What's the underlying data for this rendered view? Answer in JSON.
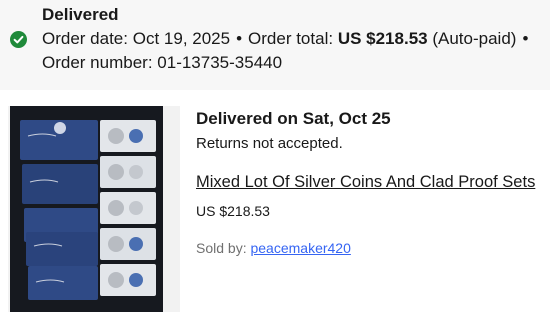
{
  "order_summary": {
    "status": "Delivered",
    "order_date_label": "Order date:",
    "order_date": "Oct 19, 2025",
    "bullet": "•",
    "order_total_label": "Order total:",
    "order_total": "US $218.53",
    "payment_note": "(Auto-paid)",
    "order_number_label": "Order number:",
    "order_number": "01-13735-35440",
    "status_icon": "check-circle-icon",
    "status_color": "#1f8a3a"
  },
  "item": {
    "delivery_heading": "Delivered on Sat, Oct 25",
    "returns_note": "Returns not accepted.",
    "title": "Mixed Lot Of Silver Coins And Clad Proof Sets",
    "price": "US $218.53",
    "seller_label": "Sold by:",
    "seller_name": "peacemaker420",
    "link_color": "#3665f3"
  }
}
